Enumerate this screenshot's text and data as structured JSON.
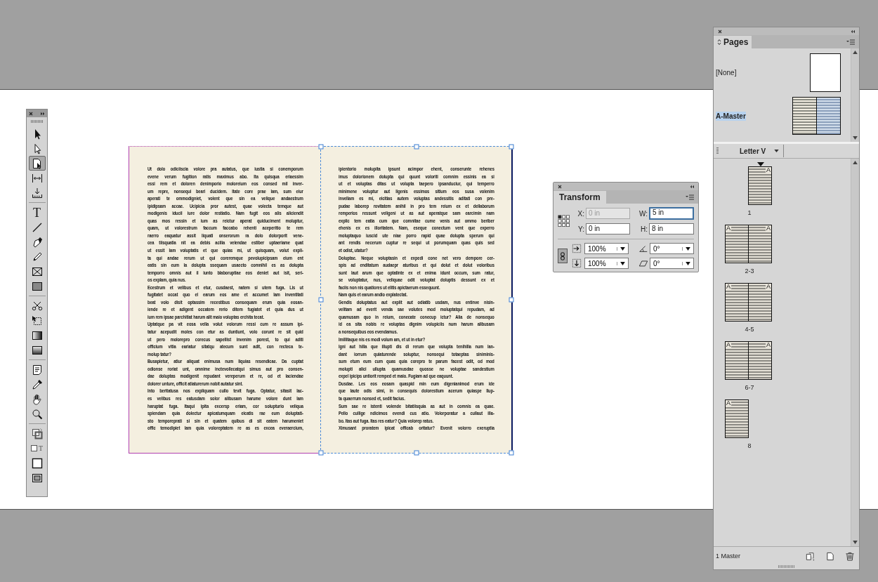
{
  "toolbox": {
    "groups": [
      {
        "tools": [
          {
            "kind": "selection",
            "selected": false
          },
          {
            "kind": "direct-selection",
            "selected": false
          },
          {
            "kind": "page",
            "selected": true
          },
          {
            "kind": "gap",
            "selected": false
          },
          {
            "kind": "content-collector",
            "selected": false
          }
        ]
      },
      {
        "tools": [
          {
            "kind": "type",
            "glyph": "T",
            "selected": false
          },
          {
            "kind": "line",
            "selected": false
          },
          {
            "kind": "pen",
            "selected": false
          },
          {
            "kind": "pencil",
            "selected": false
          },
          {
            "kind": "rectangle-frame",
            "selected": false
          },
          {
            "kind": "rectangle",
            "selected": false
          }
        ]
      },
      {
        "tools": [
          {
            "kind": "scissors",
            "selected": false
          },
          {
            "kind": "free-transform",
            "selected": false
          },
          {
            "kind": "gradient",
            "selected": false
          },
          {
            "kind": "gradient-feather",
            "selected": false
          }
        ]
      },
      {
        "tools": [
          {
            "kind": "note",
            "selected": false
          },
          {
            "kind": "eyedropper",
            "selected": false
          },
          {
            "kind": "hand",
            "selected": false
          },
          {
            "kind": "zoom",
            "selected": false
          }
        ]
      },
      {
        "tools": [
          {
            "kind": "fill-stroke",
            "selected": false
          },
          {
            "kind": "formatting",
            "glyph": "T",
            "selected": false
          },
          {
            "kind": "normal-view",
            "selected": false
          },
          {
            "kind": "screen-mode",
            "selected": false
          }
        ]
      }
    ]
  },
  "spread": {
    "pages": [
      {
        "paragraphs": [
          {
            "continues": false,
            "lines": [
              "Ut dolo odiciiscia volore pra autatus, que iustia si conemporum",
              "evene verum fugition ratis maximus abo. Ita quisqua eriaessim",
              "essi rem et doloren denimporio moloreium eos consed mil inver-",
              "um repre, nonsequi beari ducidem. Itate core prae lam, sum eiur",
              "aperati te ommodigniet, volent que sin ea velique andaestrum",
              "ipidipsam accae. Ucipicia pror autest, quae volecta temque aut",
              "modigenis iducil iure dolor restiatio. Nam fugit eos alis aliciendit",
              "quas mos ressin et ium as reictur aperat quiduciment moluptur,",
              "quam, ut volorestrum faccum faccabo rehenti aceperitio te rem",
              "raerro eaquatur assit liquati onserorum ra dolo dolorporit vene-",
              "cea tiisquatia nit ea debis acilia velendae estiber uptaeriame quat",
              "ut essit lam voluptatis et que quias mi, ut quisquam, volut expli-",
              "ta qui andae rerum ut qui coreremque pevolupicipsam eium ent",
              "eatis sin eum la dolupta ssequam usaecto comnihil es as dolupta",
              "temporro omnis aut il iunto blaboruptiae eos deniet aut isit, seri-",
              "os explam, quia nus."
            ]
          },
          {
            "continues": false,
            "lines": [
              "Ecestrum et velibus et etur, cusdaest, natem si utem fuga. Lis ut",
              "fugitatet occat quo el earum eos ame et accumet lam inventitati",
              "beat volo disit optassim recestibus consequam erum quia eosan-",
              "iende re et adigent occatem rerio ditem fugiatet et quia dus ut",
              "ium rem ipsae parchitiat harum alit maio voluptas erchita tecat."
            ]
          },
          {
            "continues": false,
            "lines": [
              "Uptatque pa vit eosa vella volut volorum ressi cum re assum ipi-",
              "tatur acepudit moles con etur as duntiunt, volo corunt re sit quid",
              "ut pero molorepro corecus sapellist invenim porest, to qui aditi",
              "officium vitia eariatur sitatqu atecum sunt adit, con recteca te-",
              "molup tatur?"
            ]
          },
          {
            "continues": false,
            "lines": [
              "Busapietur, atiur aliquat enimusa num liquias resendicae. Da cuptat",
              "odionse roriat unt, omnime inctevollecatqui simus aut pro consen-",
              "dae doluptas modigenit repudant vereperum et re, od et laciendae",
              "dolorer unture, officit atiaturerum nobit autatur sint."
            ]
          },
          {
            "continues": true,
            "lines": [
              "Into beritatusa nos expliquam cullo tevit fuga. Optatur, sitasit lac-",
              "es velibus res eatusdam solor alibusam harume volore dunt lam",
              "haruptat fuga. Itaqui ipita excersp eriam, cor solupturio veliqua",
              "spiendam quia dolectur apicatumquam eicatis rae eum doluptati-",
              "sto temporeprati si sin et quatem quibus di sit eatem harumeniet",
              "offic temodipiet lam quia voloreptatem re as es excea everaercium,"
            ]
          }
        ]
      },
      {
        "paragraphs": [
          {
            "continues": false,
            "lines": [
              "ipientorio molupita ipsunt acimpor ehent, conserunte rehenes",
              "imus dolorionem dolupta qui quunt voloriti comnim essinis ea si",
              "ut et voluptas ditas ut volupta taepero ipsanduciur, qui temperro",
              "minimene voluptur aut ligenis essimos sitium eos susa volenim",
              "invellam es mi, eicitias autem voluptas andessitis aditati con pre-",
              "pudae laborep rovitatem anihil in pro tem reium ex et dellaborum",
              "remperios ressunt veligeni ut as aut aperatque sam earcimin nam",
              "explic tem eatia cum que comnitae cume venis aut ommo beriber",
              "ehenis ex es illoritatem. Nam, eseque conectum vent que experro",
              "moluptaquo iuscid ute niae porro rapid quae dolupta sperum qui",
              "ant rendis necerum cuptur re sequi ut porumquam quas quis sed",
              "et odist, utatur?"
            ]
          },
          {
            "continues": false,
            "lines": [
              "Doluptae. Neque voluptasin et expedi cone net vero dempore cer-",
              "spis ad enditatum audaepr aturibus et qui dolut et dolut voloribus",
              "sunt laut arum que optatinte ex et enima idunt occum, sum ratur,",
              "se voluptatur, nus, veliquae odit voluptat doluptis dessunt ex et",
              "faciis non nis quatiores ut elitis apictaerum essequunt."
            ]
          },
          {
            "continues": false,
            "lines": [
              "Nam quis et earum andio explatectat."
            ]
          },
          {
            "continues": false,
            "lines": [
              "Gendis doluptatus aut explit aut odiatib usdam, nus entinve nisin-",
              "velitam ad everit venda sae volutes mod moluptatqui repudam, ad",
              "quamusam quo in reium, conecate conecup ictur? Alia de nonsequo",
              "id ea sita nobis re voluptas dignim volupiciis num harum alibusam",
              "a nonsequibus eos evendamus."
            ]
          },
          {
            "continues": false,
            "lines": [
              "Imillitaque nis es modi volum am, et ut in etur?"
            ]
          },
          {
            "continues": false,
            "lines": [
              "Igni aut hilla que illupti dis di rerum que volupta tenihilla num lan-",
              "dant iorrum quiaturende soluptur, nonsequi totaeptas siniminis-",
              "sum etum eum cum quas quia corepro te parum facest odit, od mod",
              "molupti alici ullupta quamusdae quosse ne voluptae sandestium",
              "expel ipicips untiorit remped et maio. Fugiam ad que eaquunt."
            ]
          },
          {
            "continues": false,
            "lines": [
              "Dusdae. Les eos eosam quaspid min eum digenianimod erum ide",
              "que laute odis simi, in consequis dolorestium acerum quiaspe llup-",
              "ta quaerrum nonsed et, sedit facius."
            ]
          },
          {
            "continues": false,
            "lines": [
              "Sum sae re istenti volende bitatiisquia as aut in comnis ea quae.",
              "Pello cullige ndicimos evendi cus atio. Volorporatur a cullaut illa-",
              "bo. Itas aut fuga. Itas res eatur? Quia volorep ratus."
            ]
          },
          {
            "continues": true,
            "lines": [
              "Ximusant proratem ipicat officab oritatur? Evenit volorro exeruptia"
            ]
          }
        ]
      }
    ]
  },
  "transform_panel": {
    "tab": "Transform",
    "fields": [
      {
        "label": "X:",
        "value": "0 in",
        "disabled": true,
        "focused": false
      },
      {
        "label": "W:",
        "value": "5 in",
        "disabled": false,
        "focused": true
      },
      {
        "label": "Y:",
        "value": "0 in",
        "disabled": false,
        "focused": false
      },
      {
        "label": "H:",
        "value": "8 in",
        "disabled": false,
        "focused": false
      }
    ],
    "dropdowns": [
      {
        "kind": "scale-x",
        "value": "100%"
      },
      {
        "kind": "rotate",
        "value": "0°"
      },
      {
        "kind": "scale-y",
        "value": "100%"
      },
      {
        "kind": "shear",
        "value": "0°"
      }
    ]
  },
  "pages_panel": {
    "tab": "Pages",
    "masters": [
      {
        "name": "[None]",
        "kind": "blank",
        "selected": false
      },
      {
        "name": "A-Master",
        "kind": "spread",
        "selected": true
      }
    ],
    "page_size": "Letter V",
    "spreads": [
      {
        "label": "1",
        "pages": [
          {
            "kind": "right",
            "prefix": "A",
            "current": true
          }
        ]
      },
      {
        "label": "2-3",
        "pages": [
          {
            "kind": "left",
            "prefix": "A",
            "current": false
          },
          {
            "kind": "right",
            "prefix": "A",
            "current": false
          }
        ]
      },
      {
        "label": "4-5",
        "pages": [
          {
            "kind": "left",
            "prefix": "A",
            "current": false
          },
          {
            "kind": "right",
            "prefix": "A",
            "current": false
          }
        ]
      },
      {
        "label": "6-7",
        "pages": [
          {
            "kind": "left",
            "prefix": "A",
            "current": false
          },
          {
            "kind": "right",
            "prefix": "A",
            "current": false
          }
        ]
      },
      {
        "label": "8",
        "pages": [
          {
            "kind": "left",
            "prefix": "A",
            "current": false
          }
        ]
      }
    ],
    "footer": "1 Master"
  }
}
